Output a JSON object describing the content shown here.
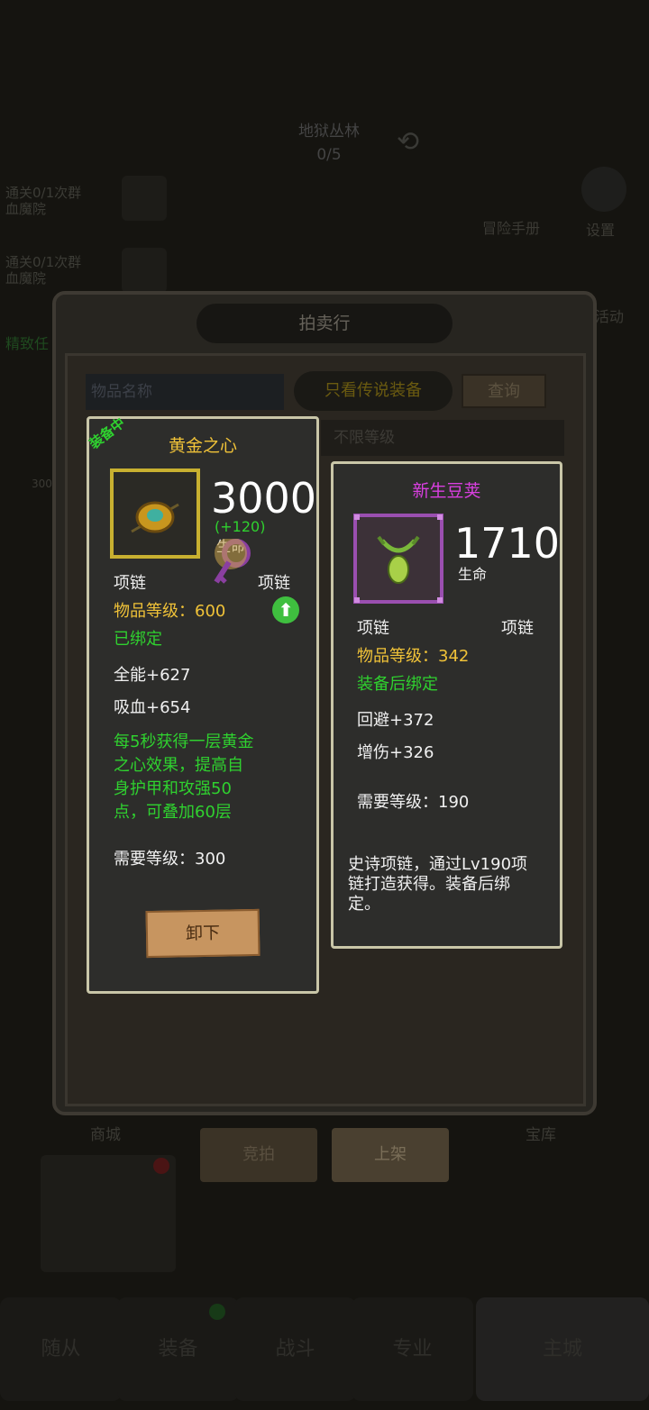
{
  "background": {
    "banner": {
      "title": "地狱丛林",
      "progress": "0/5"
    },
    "quests": [
      {
        "line1": "通关0/1次群",
        "line2": "血魔院"
      },
      {
        "line1": "通关0/1次群",
        "line2": "血魔院"
      }
    ],
    "side_left_label": "精致任",
    "adventure_manual": "冒险手册",
    "settings": "设置",
    "events": "活动",
    "badge_300": "300",
    "shop_label": "商城",
    "warehouse_label": "宝库",
    "bottom_nav": [
      "随从",
      "装备",
      "战斗",
      "专业",
      "主城"
    ]
  },
  "auction": {
    "title": "拍卖行",
    "search_placeholder": "物品名称",
    "legend_toggle": "只看传说装备",
    "query_button": "查询",
    "level_filter": "不限等级",
    "bid_button": "竞拍",
    "list_button": "上架"
  },
  "equipped_item": {
    "badge": "装备中",
    "name": "黄金之心",
    "stat_value": "3000",
    "stat_bonus": "(+120)",
    "stat_name": "生命",
    "type_left": "项链",
    "type_right": "项链",
    "item_level": "物品等级：600",
    "bind_status": "已绑定",
    "attrs": [
      "全能+627",
      "吸血+654"
    ],
    "effect": [
      "每5秒获得一层黄金",
      "之心效果，提高自",
      "身护甲和攻强50",
      "点，可叠加60层"
    ],
    "required_level": "需要等级：300",
    "unequip_button": "卸下",
    "name_color": "#f0c238"
  },
  "compare_item": {
    "name": "新生豆荚",
    "stat_value": "1710",
    "stat_name": "生命",
    "type_left": "项链",
    "type_right": "项链",
    "item_level": "物品等级：342",
    "bind_status": "装备后绑定",
    "attrs": [
      "回避+372",
      "增伤+326"
    ],
    "required_level": "需要等级：190",
    "description": [
      "史诗项链，通过Lv190项",
      "链打造获得。装备后绑",
      "定。"
    ],
    "name_color": "#d93fe0"
  }
}
